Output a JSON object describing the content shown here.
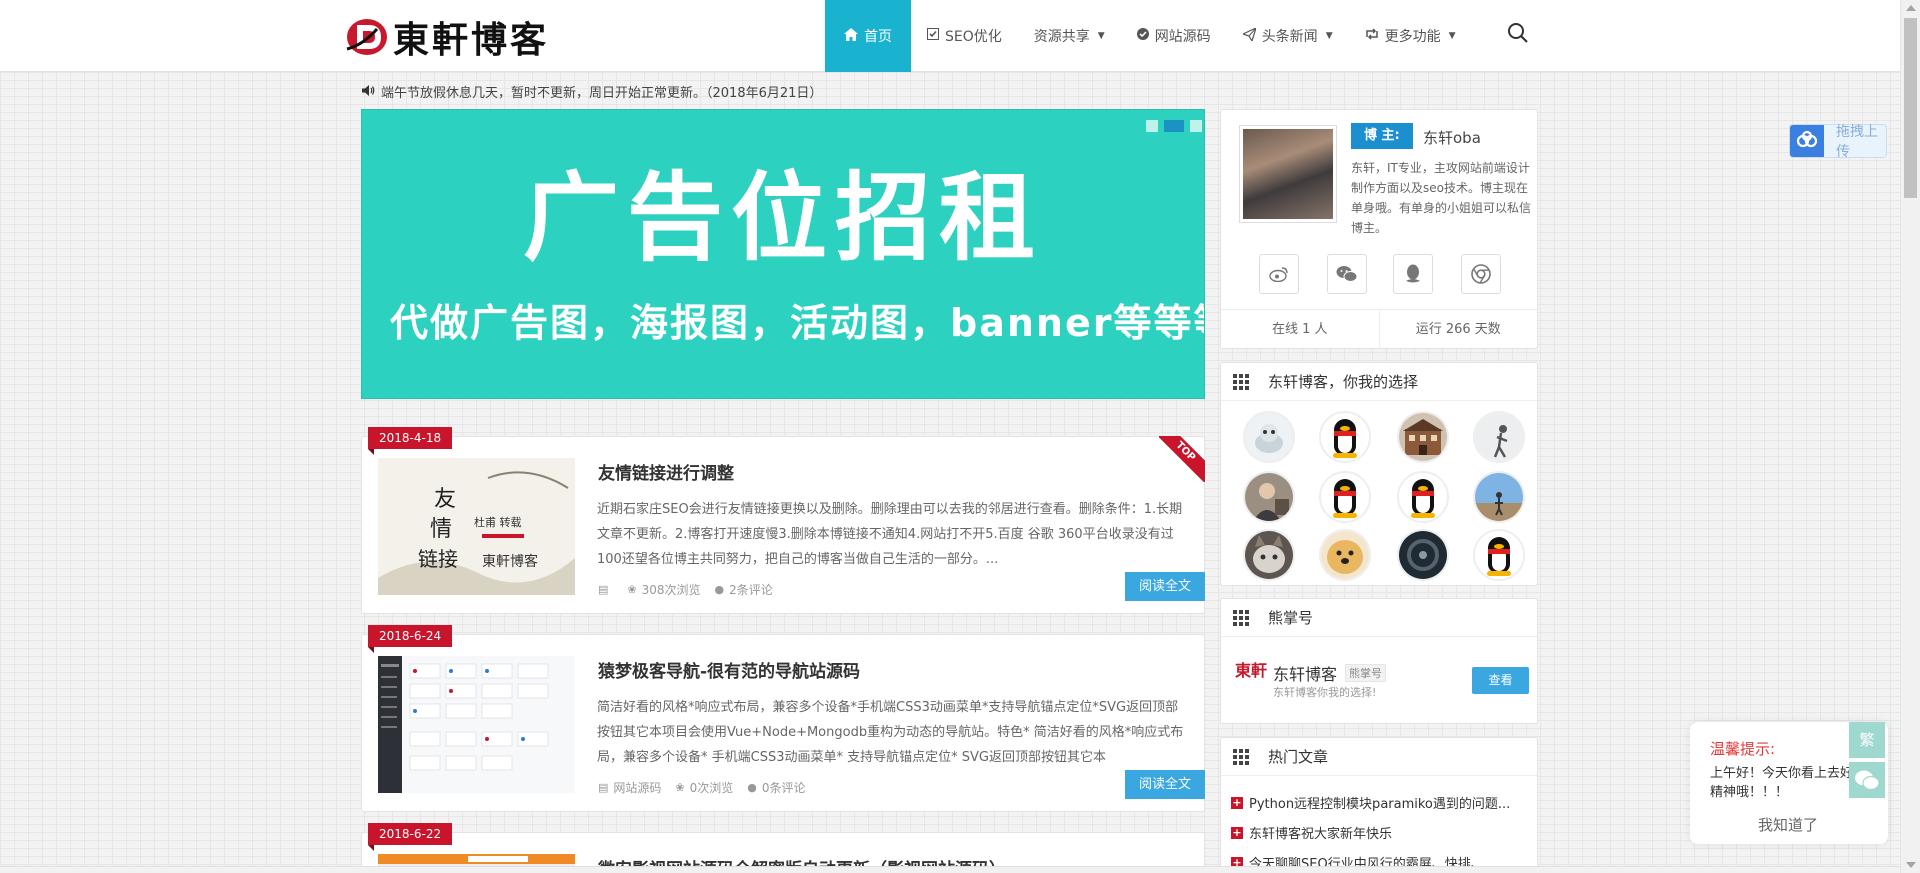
{
  "header": {
    "logo_text": "東軒博客",
    "nav": [
      {
        "label": "首页",
        "icon": "home-icon"
      },
      {
        "label": "SEO优化",
        "icon": "check-square-icon"
      },
      {
        "label": "资源共享",
        "icon": ""
      },
      {
        "label": "网站源码",
        "icon": "check-circle-icon"
      },
      {
        "label": "头条新闻",
        "icon": "paper-plane-icon"
      },
      {
        "label": "更多功能",
        "icon": "retweet-icon"
      }
    ],
    "search_icon": "search-icon"
  },
  "notice": "端午节放假休息几天，暂时不更新，周日开始正常更新。（2018年6月21日）",
  "banner": {
    "title": "广告位招租",
    "subtitle": "代做广告图，海报图，活动图，banner等等等。"
  },
  "posts": [
    {
      "date": "2018-4-18",
      "title": "友情链接进行调整",
      "excerpt": "近期石家庄SEO会进行友情链接更换以及删除。删除理由可以去我的邻居进行查看。删除条件：1.长期文章不更新。2.博客打开速度慢3.删除本博链接不通知4.网站打不开5.百度 谷歌 360平台收录没有过100还望各位博主共同努力，把自己的博客当做自己生活的一部分。...",
      "category": "",
      "views": "308次浏览",
      "comments": "2条评论",
      "read_label": "阅读全文",
      "top_label": "TOP"
    },
    {
      "date": "2018-6-24",
      "title": "猿梦极客导航-很有范的导航站源码",
      "excerpt": "简洁好看的风格*响应式布局，兼容多个设备*手机端CSS3动画菜单*支持导航锚点定位*SVG返回顶部按钮其它本项目会使用Vue+Node+Mongodb重构为动态的导航站。特色* 简洁好看的风格*响应式布局，兼容多个设备* 手机端CSS3动画菜单* 支持导航锚点定位* SVG返回顶部按钮其它本",
      "category": "网站源码",
      "views": "0次浏览",
      "comments": "0条评论",
      "read_label": "阅读全文"
    },
    {
      "date": "2018-6-22",
      "title": "微安影视网站源码全解密版自动更新（影视网站源码）"
    }
  ],
  "profile": {
    "badge": "博 主:",
    "name": "东轩oba",
    "bio": "东轩，IT专业，主攻网站前端设计制作方面以及seo技术。博主现在单身哦。有单身的小姐姐可以私信博主。",
    "social_icons": [
      "weibo-icon",
      "wechat-icon",
      "qq-icon",
      "chrome-icon"
    ],
    "online": "在线 1 人",
    "running": "运行 266 天数"
  },
  "friends_card": {
    "title": "东轩博客，你我的选择"
  },
  "xzh_card": {
    "title": "熊掌号",
    "logo": "東軒",
    "name": "东轩博客",
    "tag": "熊掌号",
    "desc": "东轩博客你我的选择!",
    "button": "查看"
  },
  "hot_card": {
    "title": "热门文章",
    "items": [
      "Python远程控制模块paramiko遇到的问题...",
      "东轩博客祝大家新年快乐",
      "今天聊聊SEO行业中风行的霸屏、快排、..."
    ]
  },
  "upload_float": {
    "label": "拖拽上传"
  },
  "tip": {
    "title": "温馨提示:",
    "message": "上午好！今天你看上去好精神哦！！！",
    "button": "我知道了"
  },
  "side_buttons": {
    "trad": "繁"
  },
  "colors": {
    "accent": "#1ab3cf",
    "banner": "#2dd1bf",
    "date_badge": "#c9152b",
    "read_button": "#3ba7e0",
    "owner_badge": "#1c8fd1"
  }
}
